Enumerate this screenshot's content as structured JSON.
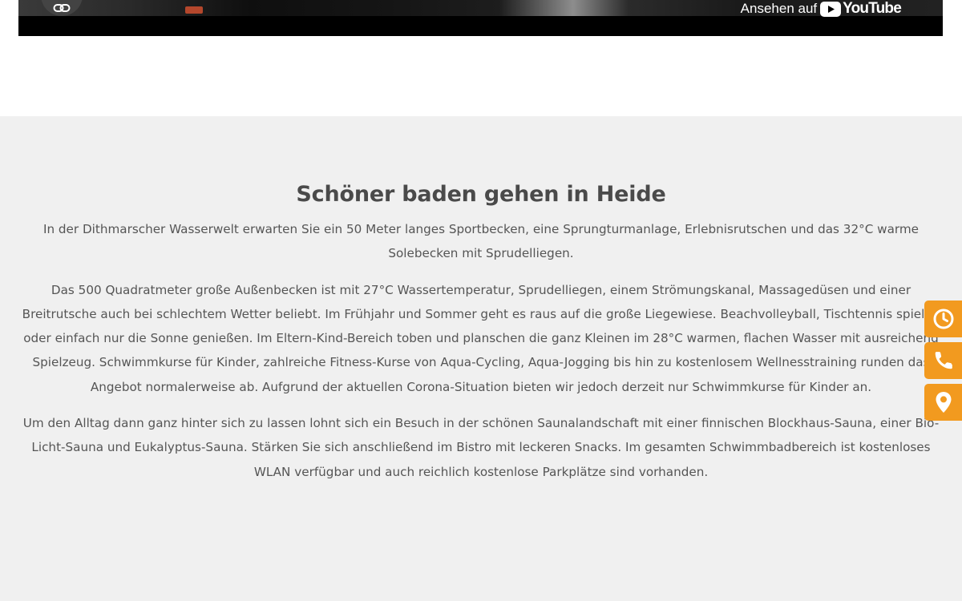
{
  "video": {
    "watch_on_label": "Ansehen auf",
    "platform_name": "YouTube",
    "link_icon": "link-icon",
    "logo_color": "#ffffff",
    "play_badge_color": "#ffffff"
  },
  "section": {
    "heading": "Schöner baden gehen in Heide",
    "paragraphs": [
      "In der Dithmarscher Wasserwelt erwarten Sie ein 50 Meter langes Sportbecken, eine Sprungturmanlage, Erlebnisrutschen und das 32°C warme Solebecken mit Sprudelliegen.",
      "Das 500 Quadratmeter große Außenbecken ist mit 27°C Wassertemperatur, Sprudelliegen, einem Strömungskanal, Massagedüsen und einer Breitrutsche auch bei schlechtem Wetter beliebt. Im Frühjahr und Sommer geht es raus auf die große Liegewiese. Beachvolleyball, Tischtennis spielen oder einfach nur die Sonne genießen. Im Eltern-Kind-Bereich toben und planschen die ganz Kleinen im 28°C warmen, flachen Wasser mit ausreichend Spielzeug. Schwimmkurse für Kinder, zahlreiche Fitness-Kurse von Aqua-Cycling, Aqua-Jogging bis hin zu kostenlosem Wellnesstraining runden das Angebot normalerweise ab. Aufgrund der aktuellen Corona-Situation bieten wir jedoch derzeit nur Schwimmkurse für Kinder an.",
      "Um den Alltag dann ganz hinter sich zu lassen lohnt sich ein Besuch in der schönen Saunalandschaft mit einer finnischen Blockhaus-Sauna, einer Bio-Licht-Sauna und Eukalyptus-Sauna. Stärken Sie sich anschließend im Bistro mit leckeren Snacks. Im gesamten Schwimmbadbereich ist kostenloses WLAN verfügbar und auch reichlich kostenlose Parkplätze sind vorhanden."
    ],
    "background_color": "#f0f0f0"
  },
  "side_buttons": [
    {
      "icon": "clock-icon"
    },
    {
      "icon": "phone-icon"
    },
    {
      "icon": "map-pin-icon"
    }
  ],
  "colors": {
    "accent": "#f29a1f",
    "text": "#555555",
    "heading": "#4a4a4a"
  }
}
